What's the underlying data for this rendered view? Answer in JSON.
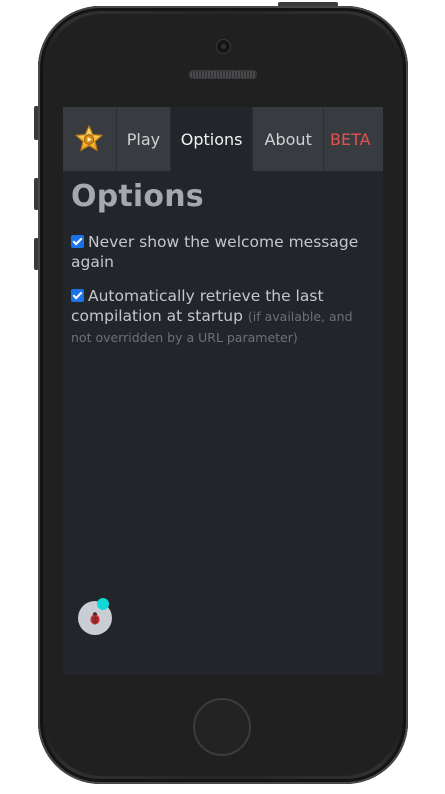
{
  "navbar": {
    "logo_icon": "star-logo-icon",
    "items": [
      {
        "label": "Play"
      },
      {
        "label": "Options",
        "active": true
      },
      {
        "label": "About"
      },
      {
        "label": "BETA",
        "color": "#e2534e"
      }
    ]
  },
  "page": {
    "title": "Options",
    "options": [
      {
        "checked": true,
        "label": "Never show the welcome message again",
        "hint": ""
      },
      {
        "checked": true,
        "label": "Automatically retrieve the last compilation at startup",
        "hint": "(if available, and not overridden by a URL parameter)"
      }
    ]
  },
  "debug_button": {
    "icon": "ladybug-icon",
    "badge_color": "#10d9d9"
  },
  "colors": {
    "screen_bg": "#22252a",
    "navbar_bg": "#383c41",
    "title": "#a5a8ad",
    "text": "#c4c7cc",
    "hint": "#6d7178",
    "accent_checkbox": "#1a73e8"
  }
}
